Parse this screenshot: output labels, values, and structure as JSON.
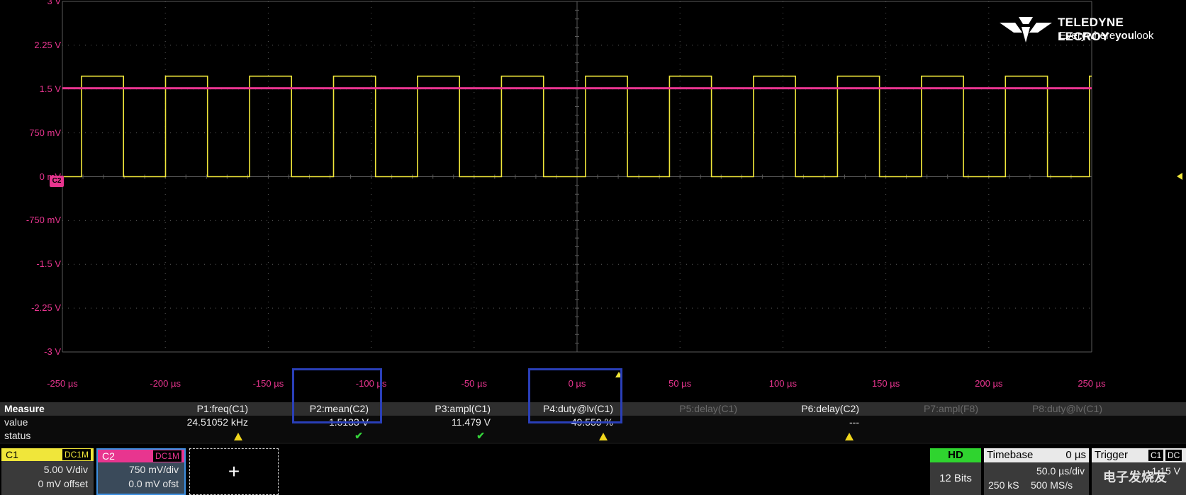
{
  "scope": {
    "brand": "TELEDYNE LECROY",
    "slogan_pre": "Everywhere",
    "slogan_bold": "you",
    "slogan_post": "look",
    "y_labels": [
      "3 V",
      "2.25 V",
      "1.5 V",
      "750 mV",
      "0 mV",
      "-750 mV",
      "-1.5 V",
      "-2.25 V",
      "-3 V"
    ],
    "x_labels": [
      "-250 µs",
      "-200 µs",
      "-150 µs",
      "-100 µs",
      "-50 µs",
      "0 µs",
      "50 µs",
      "100 µs",
      "150 µs",
      "200 µs",
      "250 µs"
    ],
    "c2_marker": "C2",
    "colors": {
      "c1": "#f0e63a",
      "c2": "#e8358f",
      "grid": "#5a5a5a",
      "highlight": "#2a3fb8"
    }
  },
  "chart_data": {
    "type": "line",
    "xlabel": "",
    "ylabel": "",
    "x_unit": "µs",
    "y_unit": "V",
    "xlim": [
      -250,
      250
    ],
    "ylim": [
      -3,
      3
    ],
    "grid": true,
    "series": [
      {
        "name": "C1",
        "color": "#f0e63a",
        "waveform": "square",
        "low": 0.0,
        "high": 1.72,
        "period_us": 40.8,
        "first_rise_us": -240.7,
        "duty": 0.4956
      },
      {
        "name": "C2",
        "color": "#e8358f",
        "waveform": "dc",
        "level": 1.5133
      }
    ]
  },
  "measure": {
    "title": "Measure",
    "row_value": "value",
    "row_status": "status",
    "params": [
      {
        "name": "P1:freq(C1)",
        "value": "24.51052 kHz",
        "status": "warn",
        "dim": false
      },
      {
        "name": "P2:mean(C2)",
        "value": "1.5133 V",
        "status": "ok",
        "dim": false
      },
      {
        "name": "P3:ampl(C1)",
        "value": "11.479 V",
        "status": "ok",
        "dim": false
      },
      {
        "name": "P4:duty@lv(C1)",
        "value": "49.559 %",
        "status": "warn",
        "dim": false
      },
      {
        "name": "P5:delay(C1)",
        "value": "",
        "status": "",
        "dim": true
      },
      {
        "name": "P6:delay(C2)",
        "value": "---",
        "status": "warn",
        "dim": false
      },
      {
        "name": "P7:ampl(F8)",
        "value": "",
        "status": "",
        "dim": true
      },
      {
        "name": "P8:duty@lv(C1)",
        "value": "",
        "status": "",
        "dim": true
      }
    ],
    "check_glyph": "✔"
  },
  "channels": {
    "c1": {
      "name": "C1",
      "coupling": "DC1M",
      "vdiv": "5.00 V/div",
      "offset": "0 mV offset"
    },
    "c2": {
      "name": "C2",
      "coupling": "DC1M",
      "vdiv": "750 mV/div",
      "offset": "0.0 mV ofst"
    },
    "add_label": "+"
  },
  "status": {
    "hd": "HD",
    "bits": "12 Bits",
    "timebase_label": "Timebase",
    "timebase_delay": "0 µs",
    "timebase_div": "50.0 µs/div",
    "samples": "250 kS",
    "rate": "500 MS/s",
    "trigger_label": "Trigger",
    "trigger_src": "C1",
    "trigger_coupling": "DC",
    "trigger_level": "1.15 V"
  },
  "watermark": "电子发烧友"
}
